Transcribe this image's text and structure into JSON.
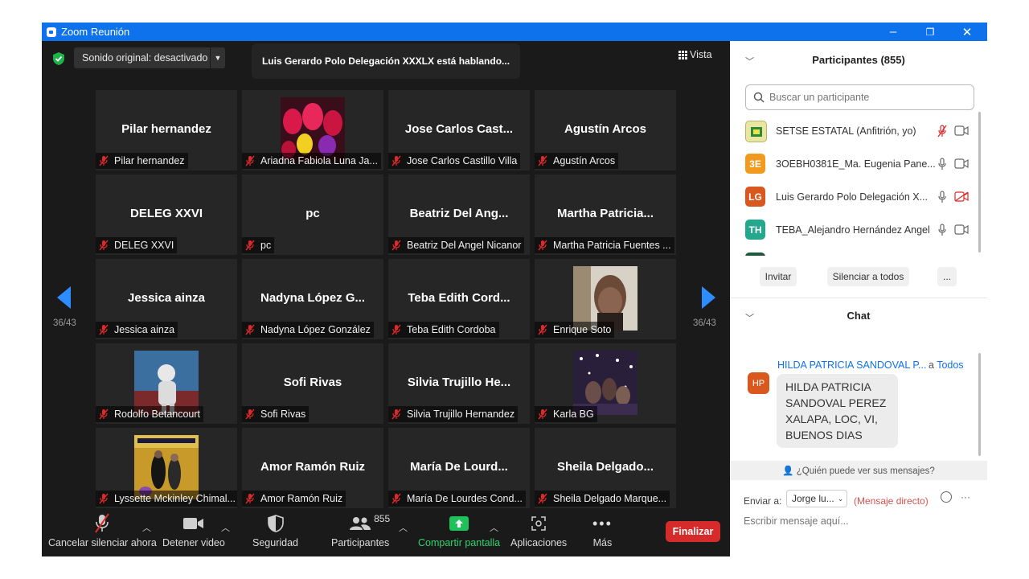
{
  "window": {
    "title": "Zoom Reunión",
    "minimize": "–",
    "restore": "❐",
    "close": "✕"
  },
  "top": {
    "sound_original": "Sonido original: desactivado",
    "speaking": "Luis Gerardo Polo Delegación XXXLX está hablando...",
    "view": "Vista"
  },
  "pagination": {
    "left": "36/43",
    "right": "36/43"
  },
  "tiles": [
    {
      "name": "Pilar hernandez",
      "caption": "Pilar hernandez",
      "photo": null
    },
    {
      "name": "",
      "caption": "Ariadna Fabiola Luna Ja...",
      "photo": "tulips"
    },
    {
      "name": "Jose Carlos Cast...",
      "caption": "Jose Carlos Castillo Villa",
      "photo": null
    },
    {
      "name": "Agustín Arcos",
      "caption": "Agustín Arcos",
      "photo": null
    },
    {
      "name": "DELEG XXVI",
      "caption": "DELEG XXVI",
      "photo": null
    },
    {
      "name": "pc",
      "caption": "pc",
      "photo": null
    },
    {
      "name": "Beatriz Del Ang...",
      "caption": "Beatriz Del Angel Nicanor",
      "photo": null
    },
    {
      "name": "Martha  Patricia...",
      "caption": "Martha Patricia Fuentes ...",
      "photo": null
    },
    {
      "name": "Jessica ainza",
      "caption": "Jessica ainza",
      "photo": null
    },
    {
      "name": "Nadyna López G...",
      "caption": "Nadyna López González",
      "photo": null
    },
    {
      "name": "Teba  Edith  Cord...",
      "caption": "Teba Edith Cordoba",
      "photo": null
    },
    {
      "name": "",
      "caption": "Enrique Soto",
      "photo": "portrait"
    },
    {
      "name": "",
      "caption": "Rodolfo Betancourt",
      "photo": "astronaut"
    },
    {
      "name": "Sofi Rivas",
      "caption": "Sofi Rivas",
      "photo": null
    },
    {
      "name": "Silvia  Trujillo  He...",
      "caption": "Silvia Trujillo Hernandez",
      "photo": null
    },
    {
      "name": "",
      "caption": "Karla BG",
      "photo": "lights"
    },
    {
      "name": "",
      "caption": "Lyssette Mckinley Chimal...",
      "photo": "family"
    },
    {
      "name": "Amor Ramón Ruiz",
      "caption": "Amor Ramón Ruiz",
      "photo": null
    },
    {
      "name": "María  De  Lourd...",
      "caption": "María De Lourdes Cond...",
      "photo": null
    },
    {
      "name": "Sheila  Delgado...",
      "caption": "Sheila Delgado Marque...",
      "photo": null
    }
  ],
  "toolbar": {
    "unmute": "Cancelar silenciar ahora",
    "stop_video": "Detener video",
    "security": "Seguridad",
    "participants": "Participantes",
    "participants_count": "855",
    "share": "Compartir pantalla",
    "apps": "Aplicaciones",
    "more": "Más",
    "end": "Finalizar"
  },
  "participants_panel": {
    "title": "Participantes (855)",
    "search_placeholder": "Buscar un participante",
    "list": [
      {
        "initials": "",
        "name": "SETSE ESTATAL (Anfitrión, yo)",
        "color": "#e8e6a0"
      },
      {
        "initials": "3E",
        "name": "3OEBH0381E_Ma. Eugenia Pane...",
        "color": "#f29a1d"
      },
      {
        "initials": "LG",
        "name": "Luis Gerardo Polo Delegación X...",
        "color": "#d8581d"
      },
      {
        "initials": "TH",
        "name": "TEBA_Alejandro Hernández Angel",
        "color": "#23a78d"
      }
    ],
    "invite": "Invitar",
    "mute_all": "Silenciar a todos",
    "more": "..."
  },
  "chat": {
    "title": "Chat",
    "sender": "HILDA PATRICIA SANDOVAL P...",
    "to_prefix": "a",
    "to": "Todos",
    "avatar": "HP",
    "message": "HILDA PATRICIA SANDOVAL PEREZ XALAPA, LOC, VI, BUENOS DIAS",
    "who_can_see": "¿Quién puede ver sus mensajes?",
    "send_to_label": "Enviar a:",
    "send_to_value": "Jorge lu...",
    "direct": "(Mensaje directo)",
    "more": "···",
    "input_placeholder": "Escribir mensaje aquí..."
  },
  "colors": {
    "accent": "#0e72ed",
    "arrow": "#2d8cff",
    "end": "#d52b2b",
    "share": "#1ec15a",
    "muted": "#e02828"
  }
}
